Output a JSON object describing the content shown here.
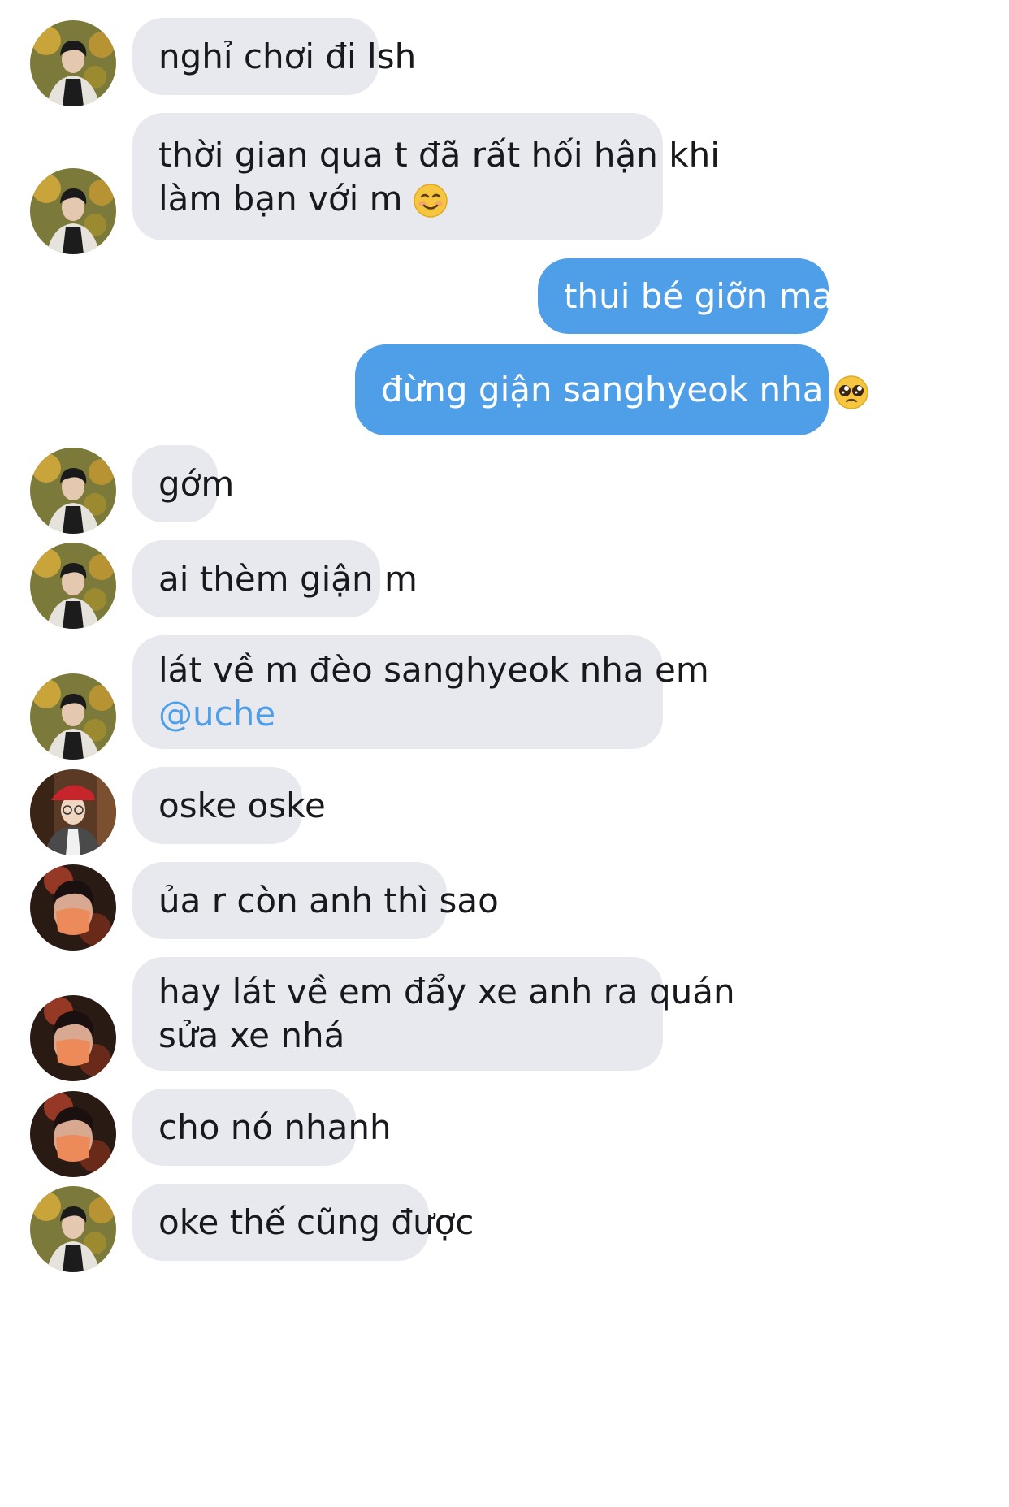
{
  "conversation": {
    "messages": [
      {
        "sender": "friend_a",
        "lines": [
          "nghỉ chơi đi lsh"
        ]
      },
      {
        "sender": "friend_a",
        "lines": [
          "thời gian qua t đã rất hối hận khi",
          "làm bạn với m"
        ],
        "emoji": "smiling-face-emoji"
      },
      {
        "sender": "me",
        "lines": [
          "thui bé giỡn mak"
        ]
      },
      {
        "sender": "me",
        "lines": [
          "đừng giận sanghyeok nha"
        ],
        "emoji": "pleading-face-emoji"
      },
      {
        "sender": "friend_a",
        "lines": [
          "gớm"
        ]
      },
      {
        "sender": "friend_a",
        "lines": [
          "ai thèm giận m"
        ]
      },
      {
        "sender": "friend_a",
        "lines": [
          "lát về m đèo sanghyeok nha em"
        ],
        "mention": "@uche"
      },
      {
        "sender": "friend_b",
        "lines": [
          "oske oske"
        ]
      },
      {
        "sender": "friend_c",
        "lines": [
          "ủa r còn anh thì sao"
        ]
      },
      {
        "sender": "friend_c",
        "lines": [
          "hay lát về em đẩy xe anh ra quán",
          "sửa xe nhá"
        ]
      },
      {
        "sender": "friend_c",
        "lines": [
          "cho nó nhanh"
        ]
      },
      {
        "sender": "friend_a",
        "lines": [
          "oke thế cũng được"
        ]
      }
    ]
  },
  "colors": {
    "incoming_bubble": "#e8e9ee",
    "outgoing_bubble": "#4f9ee8",
    "mention": "#4f9ee8"
  }
}
